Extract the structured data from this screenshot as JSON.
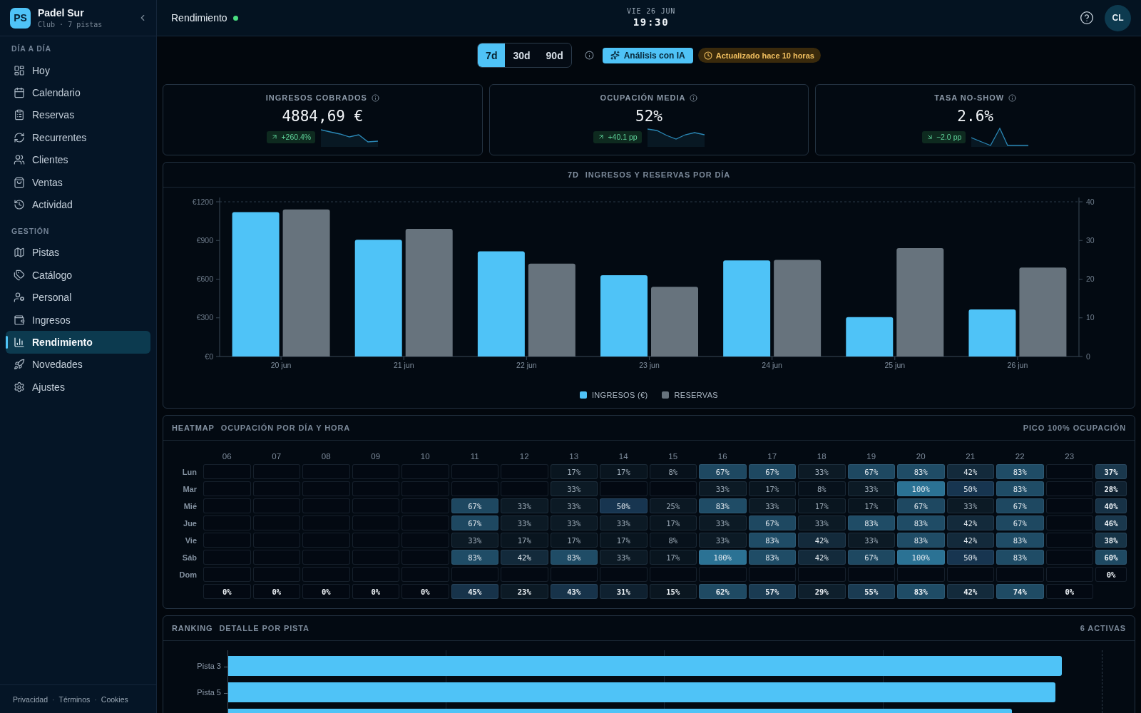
{
  "sidebar": {
    "brand": {
      "initials": "PS",
      "name": "Padel Sur",
      "subtitle": "Club · 7 pistas"
    },
    "sections": [
      {
        "title": "DÍA A DÍA",
        "items": [
          {
            "label": "Hoy",
            "selected": false
          },
          {
            "label": "Calendario",
            "selected": false
          },
          {
            "label": "Reservas",
            "selected": false
          },
          {
            "label": "Recurrentes",
            "selected": false
          },
          {
            "label": "Clientes",
            "selected": false
          },
          {
            "label": "Ventas",
            "selected": false
          },
          {
            "label": "Actividad",
            "selected": false
          }
        ]
      },
      {
        "title": "GESTIÓN",
        "items": [
          {
            "label": "Pistas",
            "selected": false
          },
          {
            "label": "Catálogo",
            "selected": false
          },
          {
            "label": "Personal",
            "selected": false
          },
          {
            "label": "Ingresos",
            "selected": false
          },
          {
            "label": "Rendimiento",
            "selected": true
          },
          {
            "label": "Novedades",
            "selected": false
          },
          {
            "label": "Ajustes",
            "selected": false
          }
        ]
      }
    ],
    "footer": [
      {
        "kind": "link",
        "text": "Privacidad"
      },
      {
        "kind": "separator",
        "text": "·"
      },
      {
        "kind": "link",
        "text": "Términos"
      },
      {
        "kind": "separator",
        "text": "·"
      },
      {
        "kind": "link",
        "text": "Cookies"
      }
    ]
  },
  "topbar": {
    "title": "Rendimiento",
    "online": true,
    "date": "VIE 26 JUN",
    "time": "19:30",
    "avatar": "CL"
  },
  "controls": {
    "ranges": [
      {
        "label": "7d",
        "selected": true
      },
      {
        "label": "30d",
        "selected": false
      },
      {
        "label": "90d",
        "selected": false
      }
    ],
    "ai_button": "Análisis con IA",
    "updated": "Actualizado hace 10 horas"
  },
  "kpis": [
    {
      "label": "INGRESOS COBRADOS",
      "value": "4884,69 €",
      "delta": "+260.4%",
      "rising": true
    },
    {
      "label": "OCUPACIÓN MEDIA",
      "value": "52%",
      "delta": "+40.1 pp",
      "rising": true
    },
    {
      "label": "TASA NO-SHOW",
      "value": "2.6%",
      "delta": "−2.0 pp",
      "rising": false
    }
  ],
  "chart": {
    "tag": "7D",
    "title": "INGRESOS Y RESERVAS POR DÍA",
    "chart_data": {
      "type": "bar",
      "stacked": false,
      "legend": "bottom",
      "categories": [
        "20 jun",
        "21 jun",
        "22 jun",
        "23 jun",
        "24 jun",
        "25 jun",
        "26 jun"
      ],
      "series": [
        {
          "name": "INGRESOS (€)",
          "color": "#4fc3f7",
          "values": [
            1120,
            905,
            815,
            630,
            745,
            305,
            365
          ]
        },
        {
          "name": "RESERVAS",
          "color": "#67737d",
          "axis": "y2",
          "values": [
            38,
            33,
            24,
            18,
            25,
            28,
            23
          ]
        }
      ],
      "ylim": [
        0,
        1200
      ],
      "yticks": [
        {
          "value": 0,
          "label": "€0"
        },
        {
          "value": 300,
          "label": "€300"
        },
        {
          "value": 600,
          "label": "€600"
        },
        {
          "value": 900,
          "label": "€900"
        },
        {
          "value": 1200,
          "label": "€1200"
        }
      ],
      "y2lim": [
        0,
        40
      ],
      "y2ticks": [
        0,
        10,
        20,
        30,
        40
      ]
    }
  },
  "heatmap": {
    "tag": "HEATMAP",
    "title": "OCUPACIÓN POR DÍA Y HORA",
    "note": "PICO 100% OCUPACIÓN",
    "hours": [
      "06",
      "07",
      "08",
      "09",
      "10",
      "11",
      "12",
      "13",
      "14",
      "15",
      "16",
      "17",
      "18",
      "19",
      "20",
      "21",
      "22",
      "23"
    ],
    "rows": [
      {
        "day": "Lun",
        "cells": [
          {
            "kind": "empty"
          },
          {
            "kind": "empty"
          },
          {
            "kind": "empty"
          },
          {
            "kind": "empty"
          },
          {
            "kind": "empty"
          },
          {
            "kind": "empty"
          },
          {
            "kind": "empty"
          },
          {
            "kind": "value",
            "text": "17%",
            "color": "#09151f"
          },
          {
            "kind": "value",
            "text": "17%",
            "color": "#09151f"
          },
          {
            "kind": "value",
            "text": "8%",
            "color": "#07111b"
          },
          {
            "kind": "value",
            "text": "67%",
            "color": "#1e4861"
          },
          {
            "kind": "value",
            "text": "67%",
            "color": "#1e4861"
          },
          {
            "kind": "value",
            "text": "33%",
            "color": "#0c1a25"
          },
          {
            "kind": "value",
            "text": "67%",
            "color": "#1e4861"
          },
          {
            "kind": "value",
            "text": "83%",
            "color": "#1f4c66"
          },
          {
            "kind": "value",
            "text": "42%",
            "color": "#132a3b"
          },
          {
            "kind": "value",
            "text": "83%",
            "color": "#1f4c66"
          },
          {
            "kind": "empty"
          }
        ],
        "total": {
          "text": "37%",
          "color": "#1a384d"
        }
      },
      {
        "day": "Mar",
        "cells": [
          {
            "kind": "empty"
          },
          {
            "kind": "empty"
          },
          {
            "kind": "empty"
          },
          {
            "kind": "empty"
          },
          {
            "kind": "empty"
          },
          {
            "kind": "empty"
          },
          {
            "kind": "empty"
          },
          {
            "kind": "value",
            "text": "33%",
            "color": "#0c1a25"
          },
          {
            "kind": "empty"
          },
          {
            "kind": "empty"
          },
          {
            "kind": "value",
            "text": "33%",
            "color": "#0c1a25"
          },
          {
            "kind": "value",
            "text": "17%",
            "color": "#09151f"
          },
          {
            "kind": "value",
            "text": "8%",
            "color": "#07111b"
          },
          {
            "kind": "value",
            "text": "33%",
            "color": "#0c1a25"
          },
          {
            "kind": "value",
            "text": "100%",
            "color": "#2b7294"
          },
          {
            "kind": "value",
            "text": "50%",
            "color": "#173550"
          },
          {
            "kind": "value",
            "text": "83%",
            "color": "#1f4c66"
          },
          {
            "kind": "empty"
          }
        ],
        "total": {
          "text": "28%",
          "color": "#0f2130"
        }
      },
      {
        "day": "Mié",
        "cells": [
          {
            "kind": "empty"
          },
          {
            "kind": "empty"
          },
          {
            "kind": "empty"
          },
          {
            "kind": "empty"
          },
          {
            "kind": "empty"
          },
          {
            "kind": "value",
            "text": "67%",
            "color": "#1e4861"
          },
          {
            "kind": "value",
            "text": "33%",
            "color": "#0c1a25"
          },
          {
            "kind": "value",
            "text": "33%",
            "color": "#0c1a25"
          },
          {
            "kind": "value",
            "text": "50%",
            "color": "#173550"
          },
          {
            "kind": "value",
            "text": "25%",
            "color": "#0b1823"
          },
          {
            "kind": "value",
            "text": "83%",
            "color": "#1f4c66"
          },
          {
            "kind": "value",
            "text": "33%",
            "color": "#0c1a25"
          },
          {
            "kind": "value",
            "text": "17%",
            "color": "#09151f"
          },
          {
            "kind": "value",
            "text": "17%",
            "color": "#09151f"
          },
          {
            "kind": "value",
            "text": "67%",
            "color": "#1e4861"
          },
          {
            "kind": "value",
            "text": "33%",
            "color": "#0c1a25"
          },
          {
            "kind": "value",
            "text": "67%",
            "color": "#1e4861"
          },
          {
            "kind": "empty"
          }
        ],
        "total": {
          "text": "40%",
          "color": "#173246"
        }
      },
      {
        "day": "Jue",
        "cells": [
          {
            "kind": "empty"
          },
          {
            "kind": "empty"
          },
          {
            "kind": "empty"
          },
          {
            "kind": "empty"
          },
          {
            "kind": "empty"
          },
          {
            "kind": "value",
            "text": "67%",
            "color": "#1e4861"
          },
          {
            "kind": "value",
            "text": "33%",
            "color": "#0c1a25"
          },
          {
            "kind": "value",
            "text": "33%",
            "color": "#0c1a25"
          },
          {
            "kind": "value",
            "text": "33%",
            "color": "#0c1a25"
          },
          {
            "kind": "value",
            "text": "17%",
            "color": "#09151f"
          },
          {
            "kind": "value",
            "text": "33%",
            "color": "#0c1a25"
          },
          {
            "kind": "value",
            "text": "67%",
            "color": "#1e4861"
          },
          {
            "kind": "value",
            "text": "33%",
            "color": "#0c1a25"
          },
          {
            "kind": "value",
            "text": "83%",
            "color": "#1f4c66"
          },
          {
            "kind": "value",
            "text": "83%",
            "color": "#1f4c66"
          },
          {
            "kind": "value",
            "text": "42%",
            "color": "#132a3b"
          },
          {
            "kind": "value",
            "text": "67%",
            "color": "#1e4861"
          },
          {
            "kind": "empty"
          }
        ],
        "total": {
          "text": "46%",
          "color": "#1a384d"
        }
      },
      {
        "day": "Vie",
        "cells": [
          {
            "kind": "empty"
          },
          {
            "kind": "empty"
          },
          {
            "kind": "empty"
          },
          {
            "kind": "empty"
          },
          {
            "kind": "empty"
          },
          {
            "kind": "value",
            "text": "33%",
            "color": "#0c1a25"
          },
          {
            "kind": "value",
            "text": "17%",
            "color": "#09151f"
          },
          {
            "kind": "value",
            "text": "17%",
            "color": "#09151f"
          },
          {
            "kind": "value",
            "text": "17%",
            "color": "#09151f"
          },
          {
            "kind": "value",
            "text": "8%",
            "color": "#07111b"
          },
          {
            "kind": "value",
            "text": "33%",
            "color": "#0c1a25"
          },
          {
            "kind": "value",
            "text": "83%",
            "color": "#1f4c66"
          },
          {
            "kind": "value",
            "text": "42%",
            "color": "#132a3b"
          },
          {
            "kind": "value",
            "text": "33%",
            "color": "#0c1a25"
          },
          {
            "kind": "value",
            "text": "83%",
            "color": "#1f4c66"
          },
          {
            "kind": "value",
            "text": "42%",
            "color": "#132a3b"
          },
          {
            "kind": "value",
            "text": "83%",
            "color": "#1f4c66"
          },
          {
            "kind": "empty"
          }
        ],
        "total": {
          "text": "38%",
          "color": "#173447"
        }
      },
      {
        "day": "Sáb",
        "cells": [
          {
            "kind": "empty"
          },
          {
            "kind": "empty"
          },
          {
            "kind": "empty"
          },
          {
            "kind": "empty"
          },
          {
            "kind": "empty"
          },
          {
            "kind": "value",
            "text": "83%",
            "color": "#1f4c66"
          },
          {
            "kind": "value",
            "text": "42%",
            "color": "#132a3b"
          },
          {
            "kind": "value",
            "text": "83%",
            "color": "#1f4c66"
          },
          {
            "kind": "value",
            "text": "33%",
            "color": "#0c1a25"
          },
          {
            "kind": "value",
            "text": "17%",
            "color": "#09151f"
          },
          {
            "kind": "value",
            "text": "100%",
            "color": "#2b7294"
          },
          {
            "kind": "value",
            "text": "83%",
            "color": "#1f4c66"
          },
          {
            "kind": "value",
            "text": "42%",
            "color": "#132a3b"
          },
          {
            "kind": "value",
            "text": "67%",
            "color": "#1e4861"
          },
          {
            "kind": "value",
            "text": "100%",
            "color": "#2b7294"
          },
          {
            "kind": "value",
            "text": "50%",
            "color": "#173550"
          },
          {
            "kind": "value",
            "text": "83%",
            "color": "#1f4c66"
          },
          {
            "kind": "empty"
          }
        ],
        "total": {
          "text": "60%",
          "color": "#1f4a63"
        }
      },
      {
        "day": "Dom",
        "cells": [
          {
            "kind": "empty"
          },
          {
            "kind": "empty"
          },
          {
            "kind": "empty"
          },
          {
            "kind": "empty"
          },
          {
            "kind": "empty"
          },
          {
            "kind": "empty"
          },
          {
            "kind": "empty"
          },
          {
            "kind": "empty"
          },
          {
            "kind": "empty"
          },
          {
            "kind": "empty"
          },
          {
            "kind": "empty"
          },
          {
            "kind": "empty"
          },
          {
            "kind": "empty"
          },
          {
            "kind": "empty"
          },
          {
            "kind": "empty"
          },
          {
            "kind": "empty"
          },
          {
            "kind": "empty"
          },
          {
            "kind": "empty"
          }
        ],
        "total": {
          "text": "0%"
        }
      }
    ],
    "column_totals": [
      {
        "text": "0%"
      },
      {
        "text": "0%"
      },
      {
        "text": "0%"
      },
      {
        "text": "0%"
      },
      {
        "text": "0%"
      },
      {
        "text": "45%",
        "color": "#17334a"
      },
      {
        "text": "23%",
        "color": "#0c1a25"
      },
      {
        "text": "43%",
        "color": "#17334a"
      },
      {
        "text": "31%",
        "color": "#0f2130"
      },
      {
        "text": "15%",
        "color": "#0a1620"
      },
      {
        "text": "62%",
        "color": "#1f4a63"
      },
      {
        "text": "57%",
        "color": "#1a3b52"
      },
      {
        "text": "29%",
        "color": "#0e1f2c"
      },
      {
        "text": "55%",
        "color": "#1a3b52"
      },
      {
        "text": "83%",
        "color": "#1f4c66"
      },
      {
        "text": "42%",
        "color": "#132a3b"
      },
      {
        "text": "74%",
        "color": "#1f4b64"
      },
      {
        "text": "0%"
      }
    ]
  },
  "ranking": {
    "tag": "RANKING",
    "title": "DETALLE POR PISTA",
    "note": "6 ACTIVAS",
    "bars": [
      {
        "label": "Pista 3",
        "level": 0.954
      },
      {
        "label": "Pista 5",
        "level": 0.947
      },
      {
        "level": 0.897
      }
    ]
  }
}
